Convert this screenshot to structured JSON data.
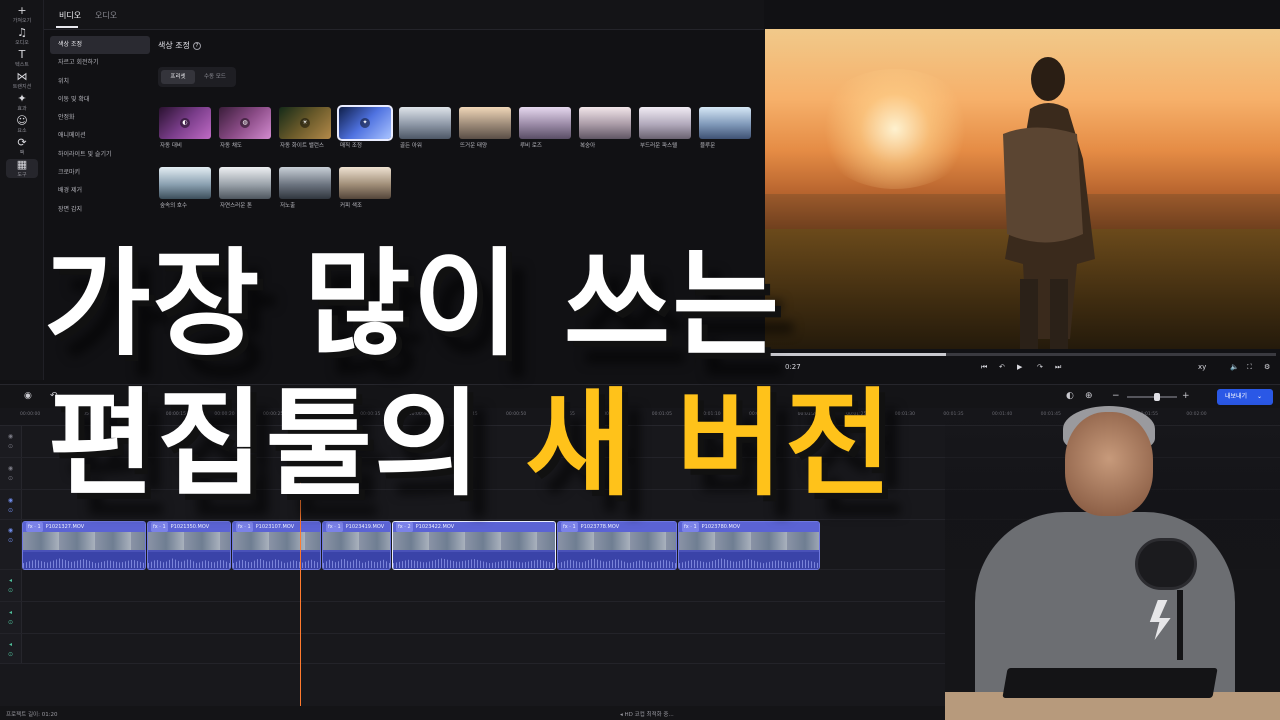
{
  "rail": [
    {
      "icon": "+",
      "label": "가져오기",
      "name": "import"
    },
    {
      "icon": "♫",
      "label": "오디오",
      "name": "audio"
    },
    {
      "icon": "T",
      "label": "텍스트",
      "name": "text"
    },
    {
      "icon": "⋈",
      "label": "트랜지션",
      "name": "transition"
    },
    {
      "icon": "✦",
      "label": "효과",
      "name": "effects"
    },
    {
      "icon": "☺",
      "label": "요소",
      "name": "elements"
    },
    {
      "icon": "⟳",
      "label": "팩",
      "name": "pack"
    },
    {
      "icon": "▦",
      "label": "도구",
      "name": "tools"
    }
  ],
  "tabs": {
    "video": "비디오",
    "audio": "오디오"
  },
  "menu": [
    "색상 조정",
    "자르고 회전하기",
    "위치",
    "이동 및 확대",
    "안정화",
    "애니메이션",
    "하이라이트 및 슬기기",
    "크로마키",
    "배경 제거",
    "장면 감지"
  ],
  "panel": {
    "title": "색상 조정",
    "help": "?",
    "segment": [
      "프리셋",
      "수동 모드"
    ]
  },
  "presets": [
    {
      "label": "자동 대비",
      "mark": "◐"
    },
    {
      "label": "자동 채도",
      "mark": "◍"
    },
    {
      "label": "자동 화이트 밸런스",
      "mark": "☀"
    },
    {
      "label": "매직 조정",
      "mark": "✦"
    },
    {
      "label": "골든 아워",
      "mark": ""
    },
    {
      "label": "뜨거운 태양",
      "mark": ""
    },
    {
      "label": "루비 로즈",
      "mark": ""
    },
    {
      "label": "복숭아",
      "mark": ""
    },
    {
      "label": "부드러운 파스텔",
      "mark": ""
    },
    {
      "label": "블루문",
      "mark": ""
    },
    {
      "label": "숲속의 호수",
      "mark": ""
    },
    {
      "label": "자연스러운 톤",
      "mark": ""
    },
    {
      "label": "저노출",
      "mark": ""
    },
    {
      "label": "커피 색조",
      "mark": ""
    }
  ],
  "player": {
    "time": "0:27",
    "zoom": "xy",
    "progress": 0.35
  },
  "toolbar": {
    "export_label": "내보내기"
  },
  "ruler": [
    "00:00:00",
    "00:00:05",
    "00:00:10",
    "00:00:15",
    "00:00:20",
    "00:00:25",
    "00:00:30",
    "00:00:35",
    "00:00:40",
    "00:00:45",
    "00:00:50",
    "00:00:55",
    "00:01:00",
    "00:01:05",
    "00:01:10",
    "00:01:15",
    "00:01:20",
    "00:01:25",
    "00:01:30",
    "00:01:35",
    "00:01:40",
    "00:01:45",
    "00:01:50",
    "00:01:55",
    "00:02:00"
  ],
  "clips": [
    {
      "fx": "fx · 1",
      "name": "P1021327.MOV"
    },
    {
      "fx": "fx · 1",
      "name": "P1021350.MOV"
    },
    {
      "fx": "fx · 1",
      "name": "P1023107.MOV"
    },
    {
      "fx": "fx · 1",
      "name": "P1023419.MOV"
    },
    {
      "fx": "fx · 2",
      "name": "P1023422.MOV"
    },
    {
      "fx": "fx · 1",
      "name": "P1023778.MOV"
    },
    {
      "fx": "fx · 1",
      "name": "P1023780.MOV"
    }
  ],
  "status": {
    "duration": "프로젝트 길이: 01:20",
    "hint": "HD 코컵 최적화 중..."
  },
  "headline": {
    "line1": "가장 많이 쓰는",
    "line2_white": "편집툴의",
    "line2_yellow": "새 버전"
  },
  "colors": {
    "accent": "#2a58e6",
    "highlight": "#ffc21a",
    "playhead": "#ff7a2e",
    "clip": "#4a52b8"
  }
}
